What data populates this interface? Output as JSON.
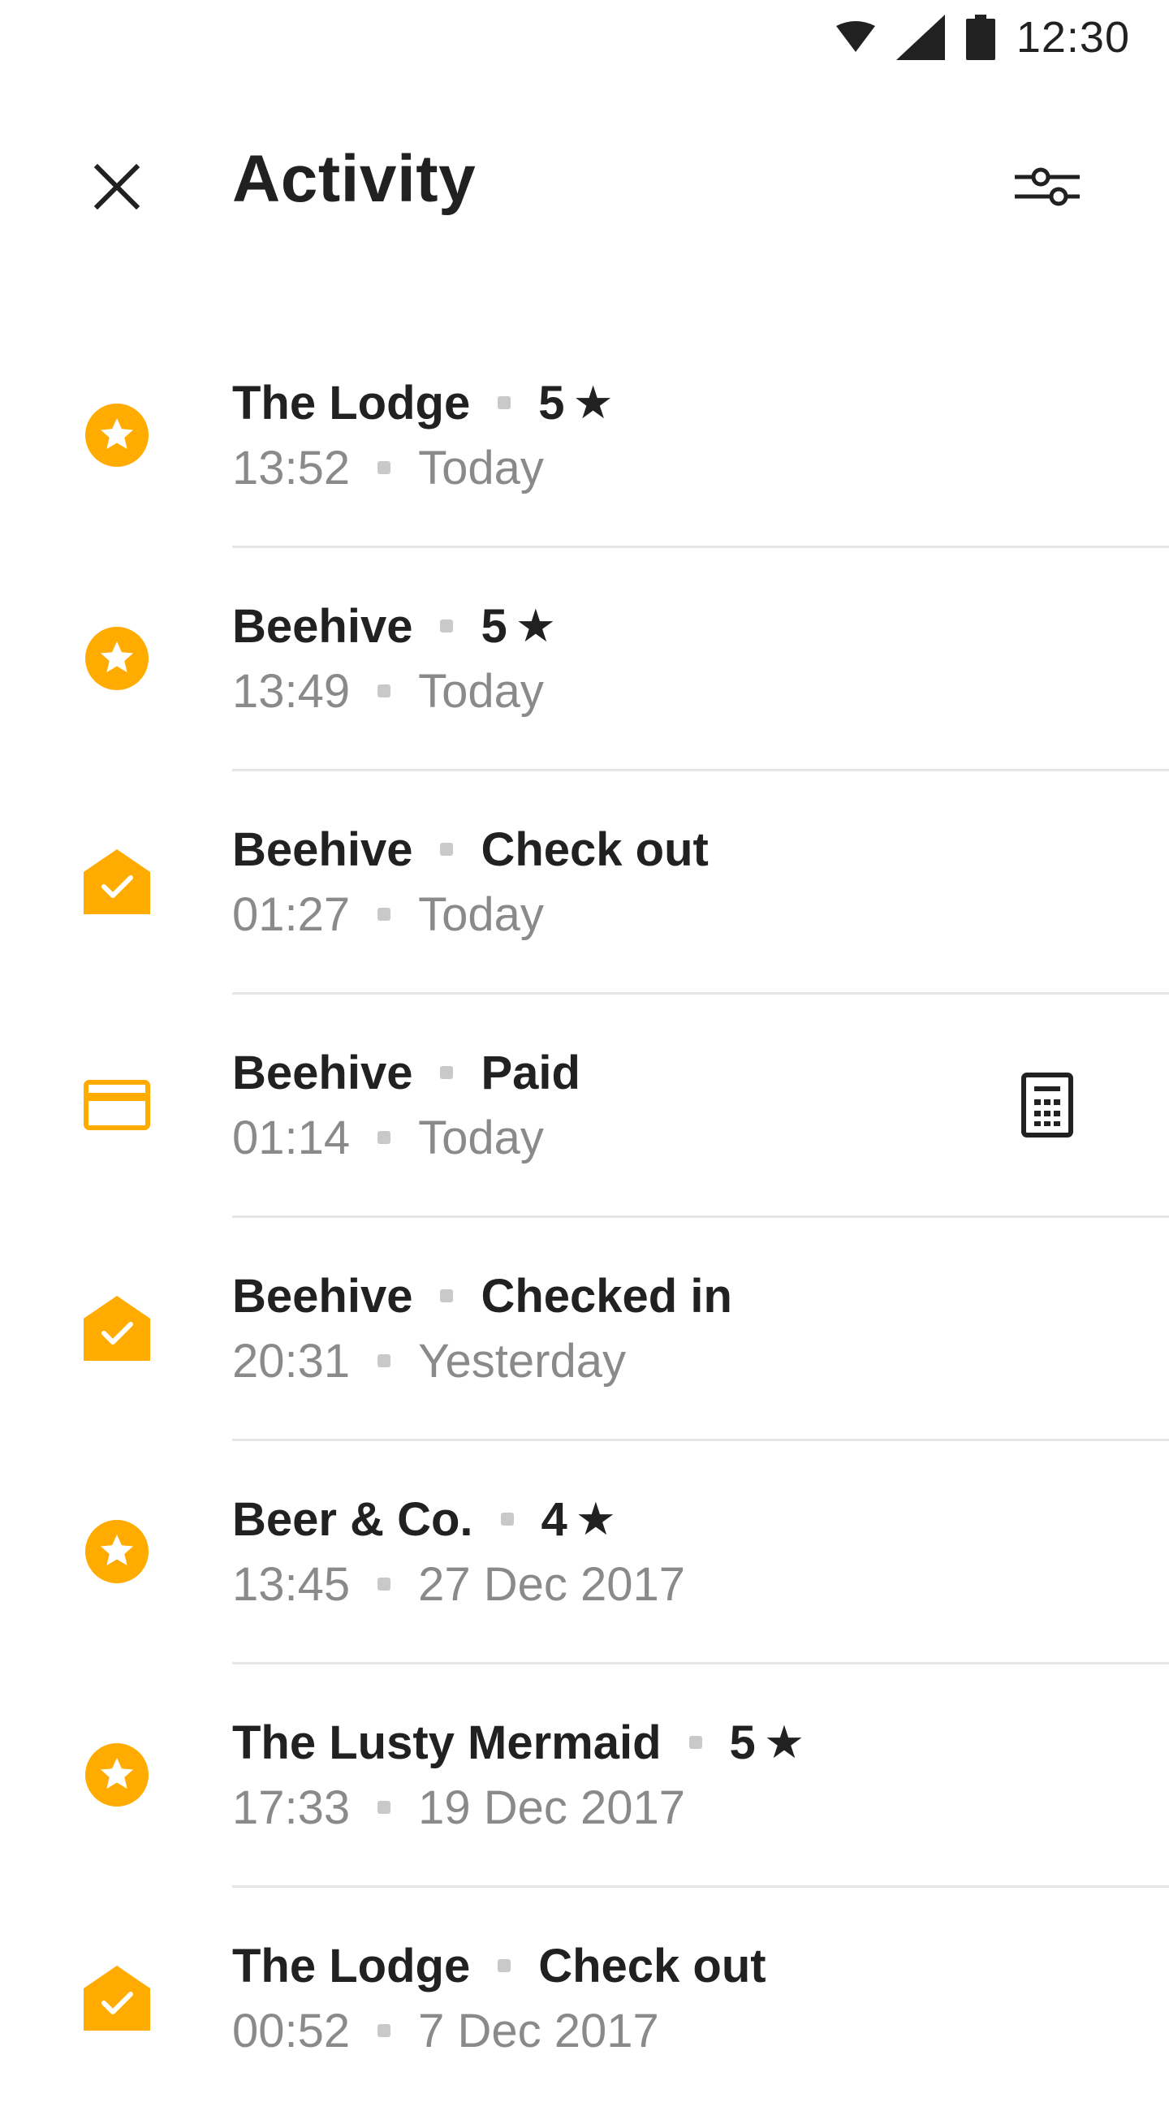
{
  "status_bar": {
    "time": "12:30"
  },
  "header": {
    "title": "Activity"
  },
  "colors": {
    "accent": "#FFAB00",
    "text": "#212121",
    "muted": "#8A8A8A"
  },
  "activities": [
    {
      "icon": "star-badge-icon",
      "place": "The Lodge",
      "detail": "5",
      "rating_star": "★",
      "time": "13:52",
      "date": "Today"
    },
    {
      "icon": "star-badge-icon",
      "place": "Beehive",
      "detail": "5",
      "rating_star": "★",
      "time": "13:49",
      "date": "Today"
    },
    {
      "icon": "house-check-icon",
      "place": "Beehive",
      "detail": "Check out",
      "rating_star": "",
      "time": "01:27",
      "date": "Today"
    },
    {
      "icon": "credit-card-icon",
      "place": "Beehive",
      "detail": "Paid",
      "rating_star": "",
      "time": "01:14",
      "date": "Today",
      "trailing_icon": "receipt-icon"
    },
    {
      "icon": "house-check-icon",
      "place": "Beehive",
      "detail": "Checked in",
      "rating_star": "",
      "time": "20:31",
      "date": "Yesterday"
    },
    {
      "icon": "star-badge-icon",
      "place": "Beer & Co.",
      "detail": "4",
      "rating_star": "★",
      "time": "13:45",
      "date": "27 Dec 2017"
    },
    {
      "icon": "star-badge-icon",
      "place": "The Lusty Mermaid",
      "detail": "5",
      "rating_star": "★",
      "time": "17:33",
      "date": "19 Dec 2017"
    },
    {
      "icon": "house-check-icon",
      "place": "The Lodge",
      "detail": "Check out",
      "rating_star": "",
      "time": "00:52",
      "date": "7 Dec 2017"
    }
  ]
}
